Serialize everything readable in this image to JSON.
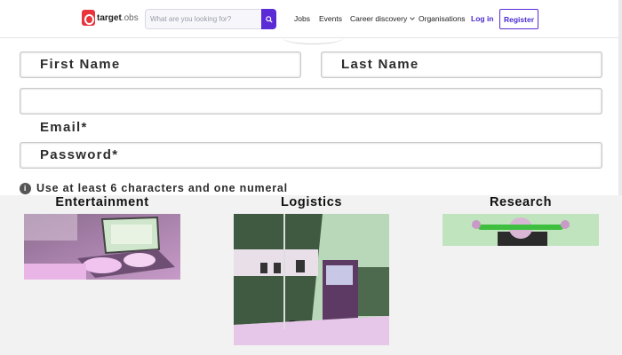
{
  "header": {
    "logo": {
      "brand": "target",
      "suffix": ".obs"
    },
    "search": {
      "placeholder": "What are you looking for?"
    },
    "nav": {
      "jobs": "Jobs",
      "events": "Events",
      "career_discovery": "Career discovery",
      "organisations": "Organisations",
      "login": "Log in",
      "register": "Register"
    },
    "accent_color": "#5b2bd6"
  },
  "form": {
    "first_name_placeholder": "First Name",
    "last_name_placeholder": "Last Name",
    "email_label": "Email*",
    "password_placeholder": "Password*",
    "password_hint": "Use at least 6 characters and one numeral"
  },
  "industries": [
    {
      "title": "Entertainment",
      "icon": "laptop-typing-image"
    },
    {
      "title": "Logistics",
      "icon": "truck-image"
    },
    {
      "title": "Research",
      "icon": "person-with-tube-image"
    }
  ]
}
